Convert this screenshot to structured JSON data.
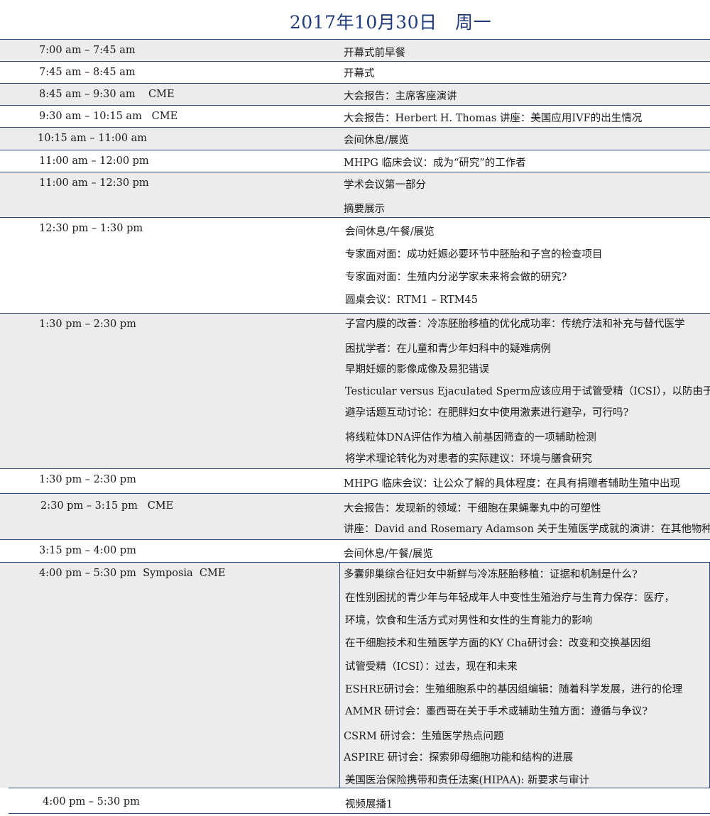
{
  "header": {
    "title": "2017年10月30日　周一"
  },
  "rows": [
    {
      "time": "7:00 am – 7:45 am",
      "items": [
        "开幕式前早餐"
      ]
    },
    {
      "time": "7:45 am – 8:45 am",
      "items": [
        "开幕式"
      ]
    },
    {
      "time": "8:45 am – 9:30 am    CME",
      "items": [
        "大会报告：主席客座演讲"
      ]
    },
    {
      "time": "9:30 am – 10:15 am   CME",
      "items": [
        "大会报告：Herbert H. Thomas 讲座：美国应用IVF的出生情况"
      ]
    },
    {
      "time": "10:15 am – 11:00 am",
      "items": [
        "会间休息/展览"
      ]
    },
    {
      "time": "11:00 am – 12:00 pm",
      "items": [
        "MHPG 临床会议：成为“研究”的工作者"
      ]
    },
    {
      "time": "11:00 am – 12:30 pm",
      "items": [
        "学术会议第一部分",
        "摘要展示"
      ]
    },
    {
      "time": "12:30 pm – 1:30 pm",
      "items": [
        "会间休息/午餐/展览",
        "专家面对面：成功妊娠必要环节中胚胎和子宫的检查项目",
        "专家面对面：生殖内分泌学家未来将会做的研究?",
        "圆桌会议：RTM1 – RTM45"
      ]
    },
    {
      "time": "1:30 pm – 2:30 pm",
      "items": [
        "子宫内膜的改善：冷冻胚胎移植的优化成功率：传统疗法和补充与替代医学",
        "困扰学者：在儿童和青少年妇科中的疑难病例",
        "早期妊娠的影像成像及易犯错误",
        "Testicular versus Ejaculated Sperm应该应用于试管受精（ICSI），以防由于精子DNA断裂",
        "避孕话题互动讨论：在肥胖妇女中使用激素进行避孕，可行吗?",
        "将线粒体DNA评估作为植入前基因筛查的一项辅助检测",
        "将学术理论转化为对患者的实际建议：环境与膳食研究"
      ]
    },
    {
      "time": "1:30 pm – 2:30 pm",
      "items": [
        "MHPG 临床会议：让公众了解的具体程度：在具有捐赠者辅助生殖中出现"
      ]
    },
    {
      "time": "2:30 pm – 3:15 pm   CME",
      "items": [
        "大会报告：发现新的领域：干细胞在果蝇睾丸中的可塑性",
        "讲座：David and Rosemary Adamson 关于生殖医学成就的演讲：在其他物种"
      ]
    },
    {
      "time": "3:15 pm – 4:00 pm",
      "items": [
        "会间休息/午餐/展览"
      ]
    },
    {
      "time": "4:00 pm – 5:30 pm  Symposia  CME",
      "items": [
        "多囊卵巢综合征妇女中新鲜与冷冻胚胎移植：证据和机制是什么?",
        "在性别困扰的青少年与年轻成年人中变性生殖治疗与生育力保存：医疗，",
        "环境，饮食和生活方式对男性和女性的生育能力的影响",
        "在干细胞技术和生殖医学方面的KY Cha研讨会：改变和交换基因组",
        "试管受精（ICSI）：过去，现在和未来",
        "ESHRE研讨会：生殖细胞系中的基因组编辑：随着科学发展，进行的伦理",
        "AMMR 研讨会：墨西哥在关于手术或辅助生殖方面：遵循与争议?",
        "CSRM 研讨会：生殖医学热点问题",
        "ASPIRE 研讨会：探索卵母细胞功能和结构的进展",
        "美国医治保险携带和责任法案(HIPAA): 新要求与审计"
      ]
    },
    {
      "time": "4:00 pm – 5:30 pm",
      "items": [
        "视频展播1"
      ]
    }
  ]
}
